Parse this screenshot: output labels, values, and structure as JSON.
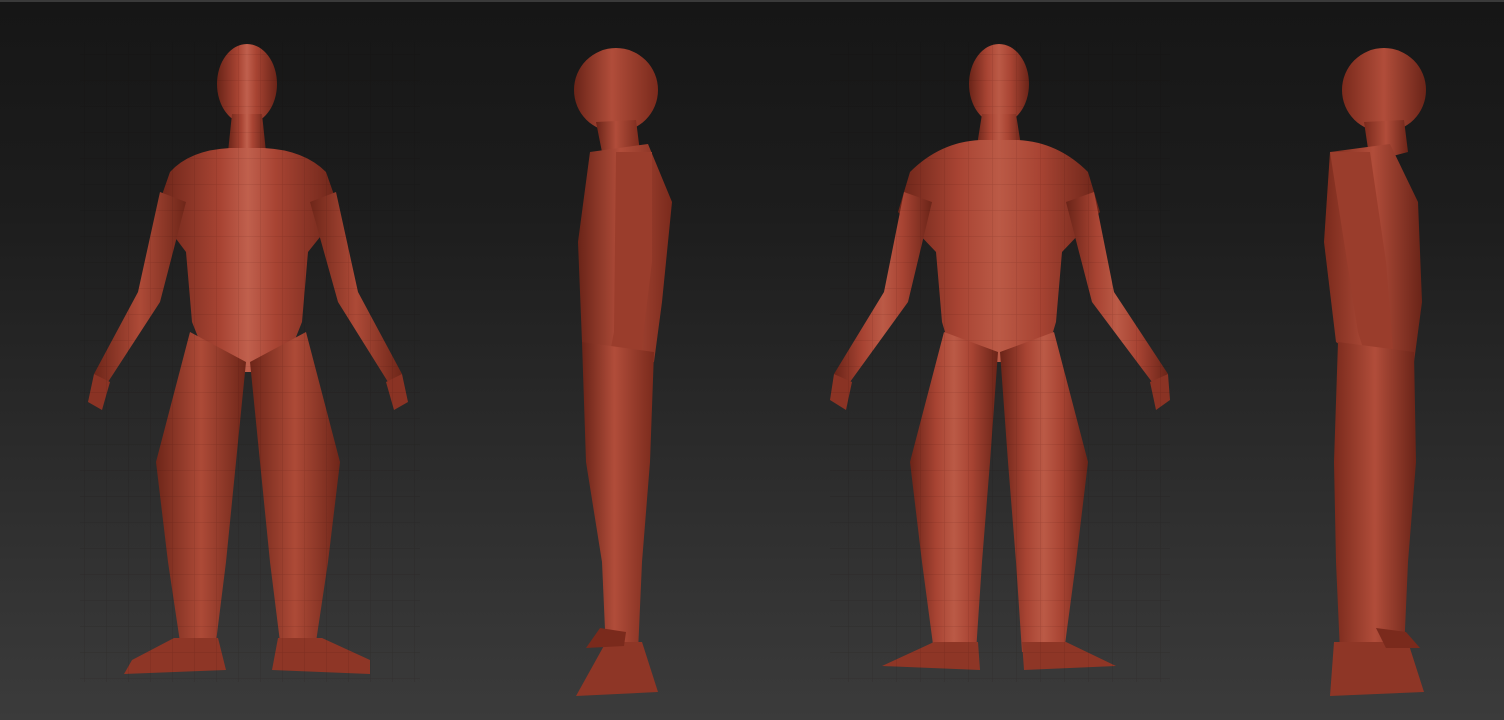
{
  "viewport": {
    "background_top": "#161616",
    "background_bottom": "#3b3b3b",
    "model_color": "#9c3a2a",
    "model_highlight": "#c8624e",
    "model_shadow": "#5a1c12",
    "wire_color": "#e09a86"
  },
  "views": [
    {
      "name": "front",
      "orientation": "front"
    },
    {
      "name": "side-left",
      "orientation": "side"
    },
    {
      "name": "back",
      "orientation": "back"
    },
    {
      "name": "side-right",
      "orientation": "side"
    }
  ]
}
